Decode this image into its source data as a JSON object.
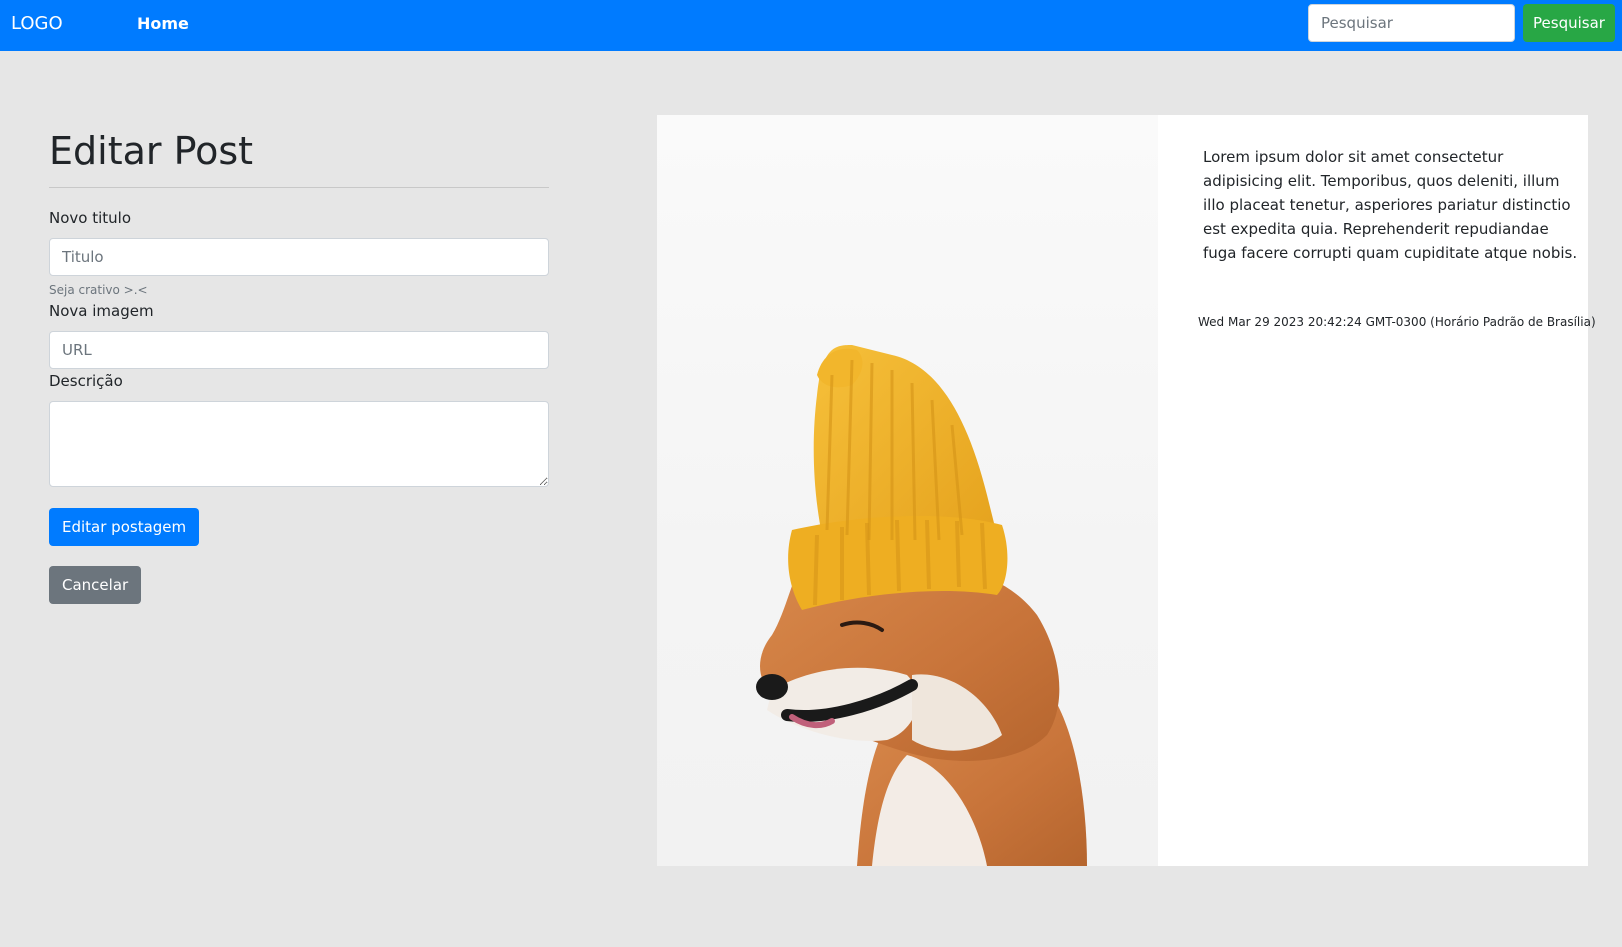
{
  "navbar": {
    "logo": "LOGO",
    "home": "Home",
    "search_placeholder": "Pesquisar",
    "search_button": "Pesquisar"
  },
  "form": {
    "title": "Editar Post",
    "title_label": "Novo titulo",
    "title_placeholder": "Titulo",
    "title_help": "Seja crativo >.<",
    "image_label": "Nova imagem",
    "image_placeholder": "URL",
    "description_label": "Descrição",
    "description_value": "",
    "submit_button": "Editar postagem",
    "cancel_button": "Cancelar"
  },
  "post": {
    "image_subject": "shiba-inu-dog-yellow-beanie",
    "text": "Lorem ipsum dolor sit amet consectetur adipisicing elit. Temporibus, quos deleniti, illum illo placeat tenetur, asperiores pariatur distinctio est expedita quia. Reprehenderit repudiandae fuga facere corrupti quam cupiditate atque nobis.",
    "date": "Wed Mar 29 2023 20:42:24 GMT-0300 (Horário Padrão de Brasília)"
  },
  "colors": {
    "primary": "#007bff",
    "success": "#28a745",
    "secondary": "#6c757d",
    "page_bg": "#e6e6e6"
  }
}
